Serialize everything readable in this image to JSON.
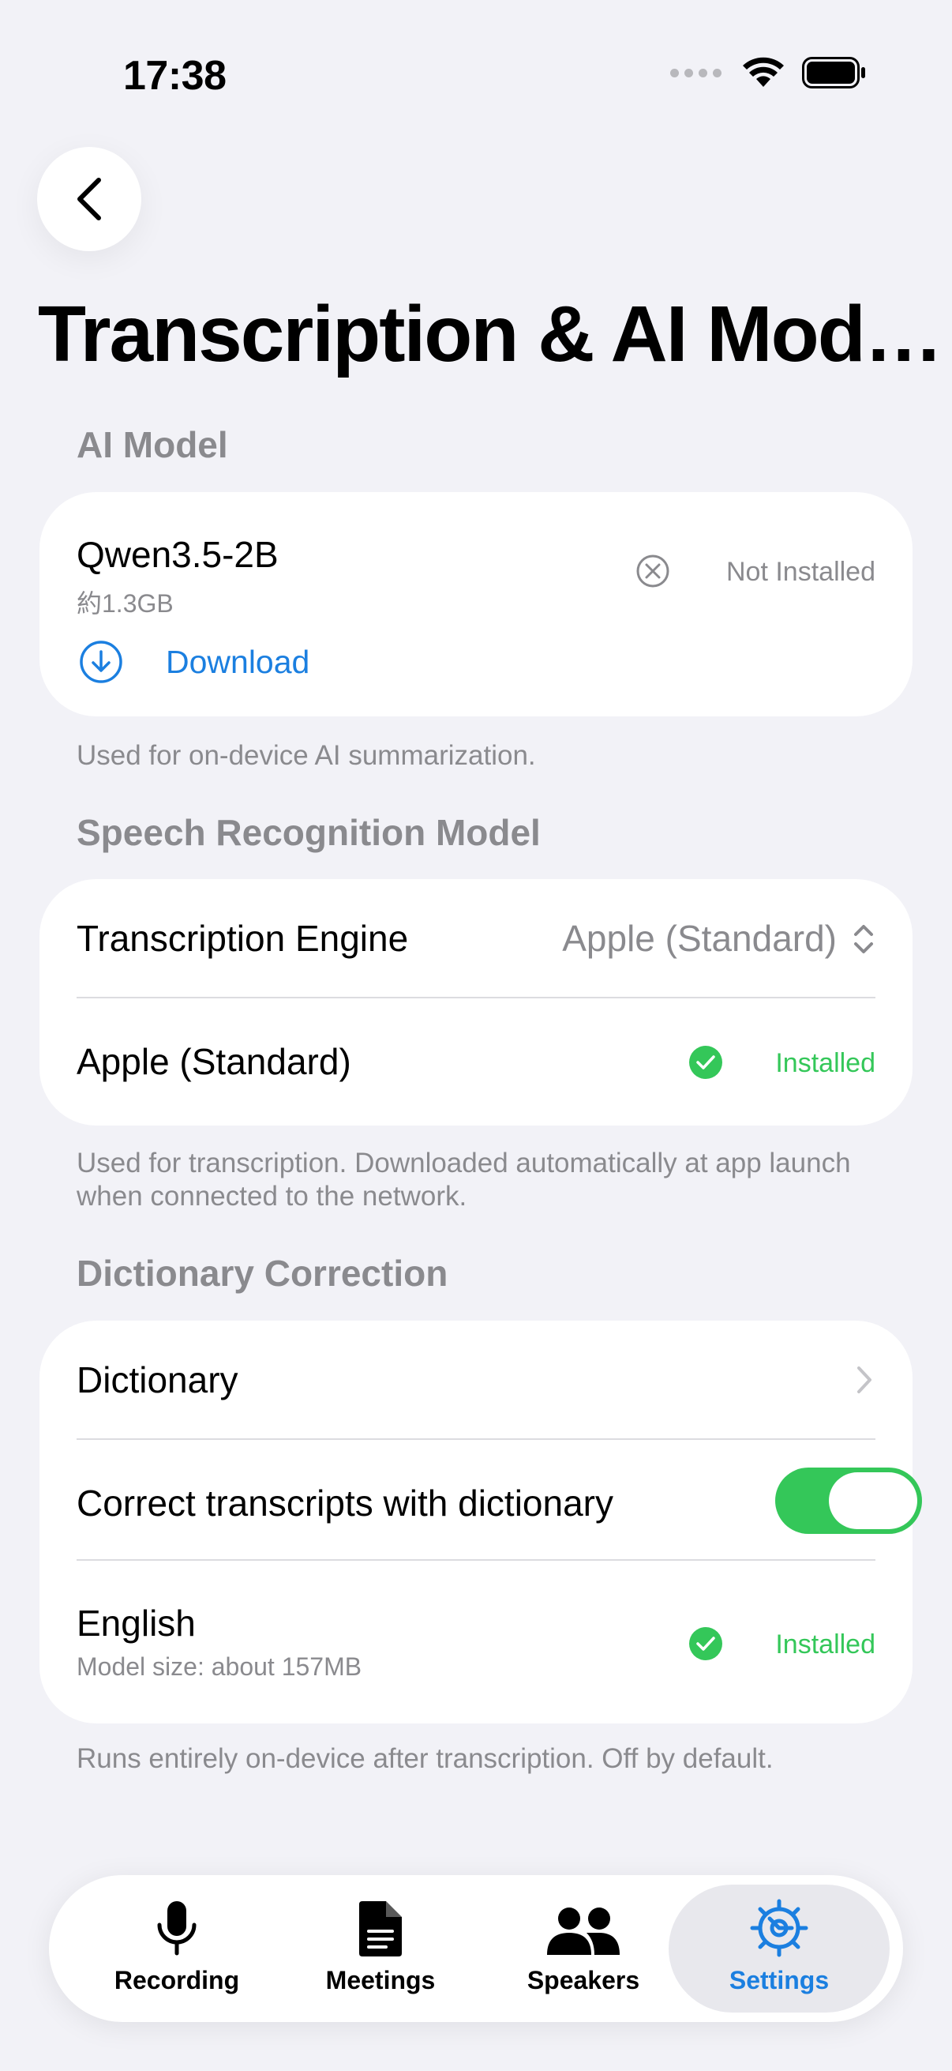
{
  "status_bar": {
    "time": "17:38"
  },
  "page_title": "Transcription & AI Mod…",
  "ai_model": {
    "header": "AI Model",
    "model_name": "Qwen3.5-2B",
    "model_size": "約1.3GB",
    "status": "Not Installed",
    "download_label": "Download",
    "footnote": "Used for on-device AI summarization."
  },
  "speech": {
    "header": "Speech Recognition Model",
    "engine_label": "Transcription Engine",
    "engine_value": "Apple (Standard)",
    "model_label": "Apple (Standard)",
    "model_status": "Installed",
    "footnote": "Used for transcription. Downloaded automatically at app launch when connected to the network."
  },
  "dictionary": {
    "header": "Dictionary Correction",
    "dictionary_label": "Dictionary",
    "correct_label": "Correct transcripts with dictionary",
    "correct_enabled": true,
    "language_label": "English",
    "language_size": "Model size: about 157MB",
    "language_status": "Installed",
    "footnote": "Runs entirely on-device after transcription. Off by default."
  },
  "tabs": [
    {
      "label": "Recording",
      "icon": "mic-icon"
    },
    {
      "label": "Meetings",
      "icon": "document-icon"
    },
    {
      "label": "Speakers",
      "icon": "people-icon"
    },
    {
      "label": "Settings",
      "icon": "gear-icon"
    }
  ],
  "colors": {
    "accent": "#1b7fe0",
    "green": "#34c759",
    "background": "#f2f2f7"
  }
}
